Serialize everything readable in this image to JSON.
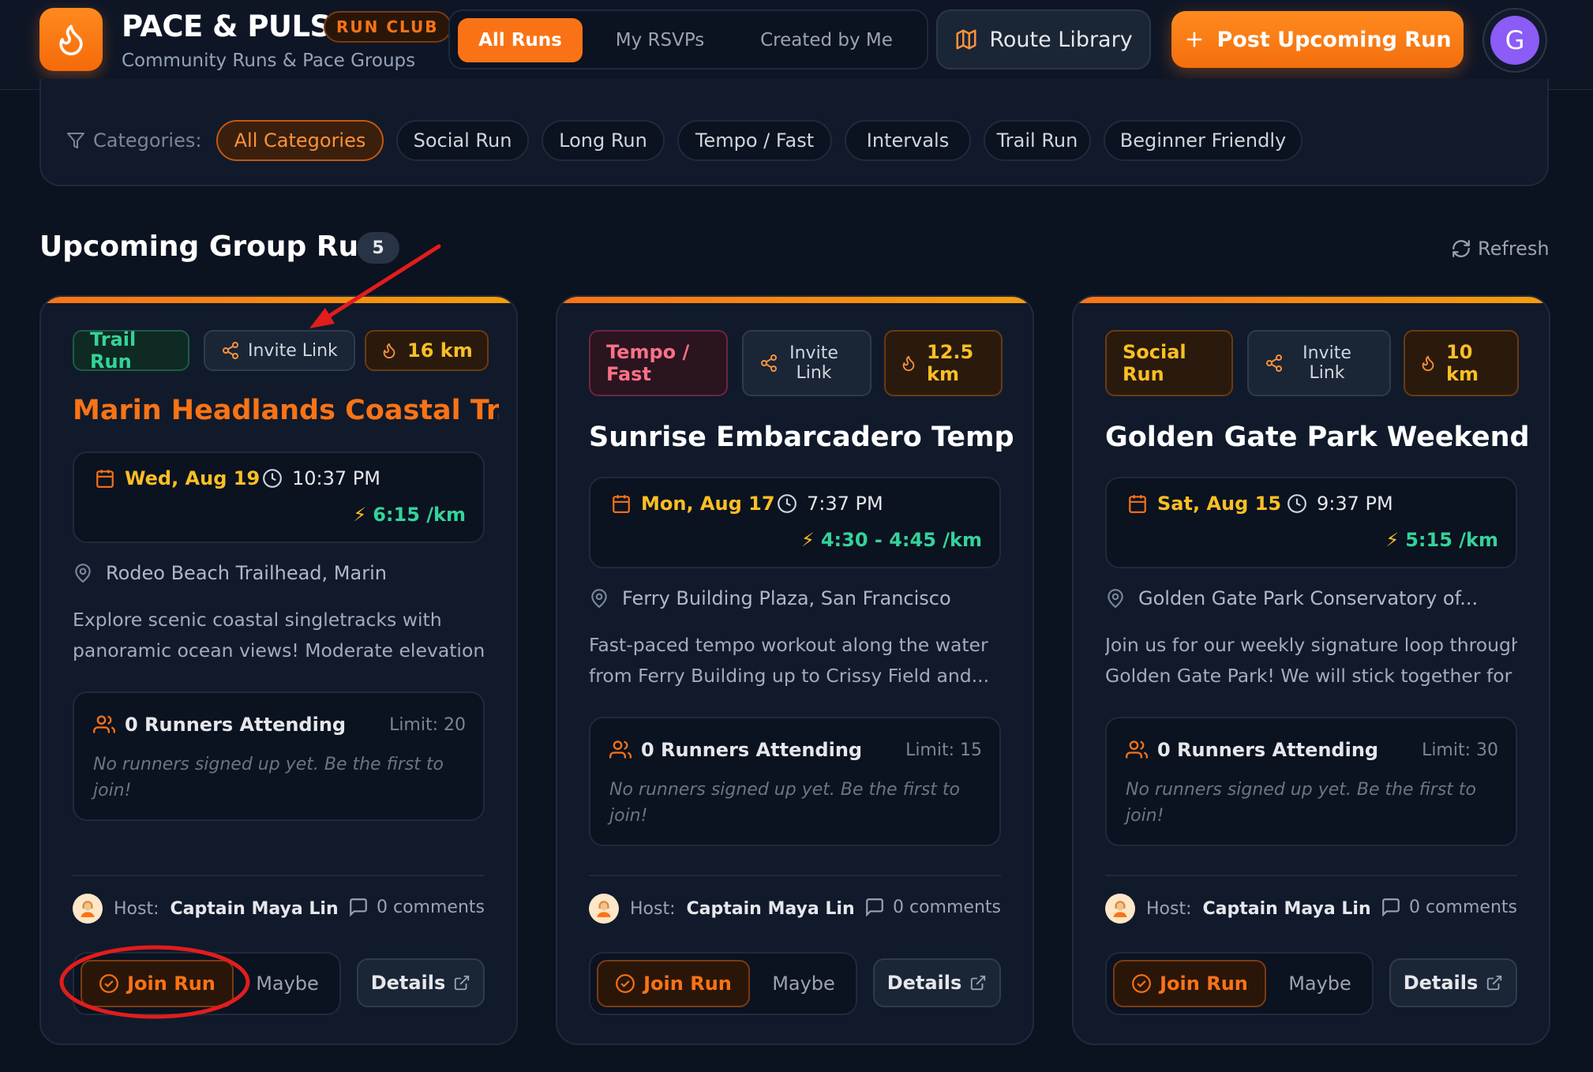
{
  "header": {
    "brand_name": "PACE & PULSE",
    "brand_badge": "RUN CLUB",
    "brand_subtitle": "Community Runs & Pace Groups",
    "tabs": [
      {
        "label": "All Runs",
        "active": true
      },
      {
        "label": "My RSVPs",
        "active": false
      },
      {
        "label": "Created by Me",
        "active": false
      }
    ],
    "route_library_label": "Route Library",
    "post_run_label": "Post Upcoming Run",
    "avatar_initial": "G"
  },
  "categories": {
    "label": "Categories:",
    "items": [
      "All Categories",
      "Social Run",
      "Long Run",
      "Tempo / Fast",
      "Intervals",
      "Trail Run",
      "Beginner Friendly"
    ],
    "selected": "All Categories"
  },
  "section": {
    "title": "Upcoming Group Runs",
    "count": "5",
    "refresh_label": "Refresh"
  },
  "cards": [
    {
      "category": "Trail Run",
      "invite_label": "Invite Link",
      "distance": "16 km",
      "title": "Marin Headlands Coastal Tr...",
      "date": "Wed, Aug 19",
      "time": "10:37 PM",
      "pace": "6:15 /km",
      "location": "Rodeo Beach Trailhead, Marin",
      "description_line1": "Explore scenic coastal singletracks with",
      "description_line2": "panoramic ocean views! Moderate elevation...",
      "attending": "0 Runners Attending",
      "limit": "Limit: 20",
      "empty_message": "No runners signed up yet. Be the first to join!",
      "host_label": "Host:",
      "host_name": "Captain Maya Lin",
      "comments": "0 comments",
      "join_label": "Join Run",
      "maybe_label": "Maybe",
      "details_label": "Details"
    },
    {
      "category": "Tempo / Fast",
      "invite_label": "Invite Link",
      "distance": "12.5 km",
      "title": "Sunrise Embarcadero Temp...",
      "date": "Mon, Aug 17",
      "time": "7:37 PM",
      "pace": "4:30 - 4:45 /km",
      "location": "Ferry Building Plaza, San Francisco",
      "description_line1": "Fast-paced tempo workout along the water",
      "description_line2": "from Ferry Building up to Crissy Field and...",
      "attending": "0 Runners Attending",
      "limit": "Limit: 15",
      "empty_message": "No runners signed up yet. Be the first to join!",
      "host_label": "Host:",
      "host_name": "Captain Maya Lin",
      "comments": "0 comments",
      "join_label": "Join Run",
      "maybe_label": "Maybe",
      "details_label": "Details"
    },
    {
      "category": "Social Run",
      "invite_label": "Invite Link",
      "distance": "10 km",
      "title": "Golden Gate Park Weekend...",
      "date": "Sat, Aug 15",
      "time": "9:37 PM",
      "pace": "5:15 /km",
      "location": "Golden Gate Park Conservatory of...",
      "description_line1": "Join us for our weekly signature loop through",
      "description_line2": "Golden Gate Park! We will stick together for ...",
      "attending": "0 Runners Attending",
      "limit": "Limit: 30",
      "empty_message": "No runners signed up yet. Be the first to join!",
      "host_label": "Host:",
      "host_name": "Captain Maya Lin",
      "comments": "0 comments",
      "join_label": "Join Run",
      "maybe_label": "Maybe",
      "details_label": "Details"
    }
  ],
  "colors": {
    "accent": "#f97316",
    "background": "#0b1220",
    "card": "#111a2b",
    "pace": "#34d399",
    "date": "#fbbf24",
    "annotation": "#e11d1d"
  }
}
